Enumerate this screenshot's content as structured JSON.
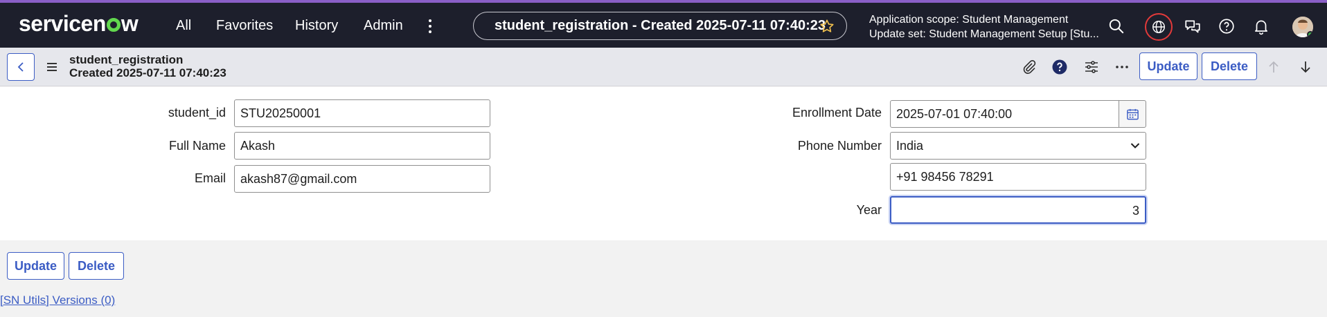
{
  "topnav": {
    "logo": "servicenow",
    "items": [
      "All",
      "Favorites",
      "History",
      "Admin"
    ],
    "record_title": "student_registration - Created 2025-07-11 07:40:23",
    "scope_line1": "Application scope: Student Management",
    "scope_line2": "Update set: Student Management Setup [Stu..."
  },
  "header": {
    "table_name": "student_registration",
    "created": "Created 2025-07-11 07:40:23",
    "update_label": "Update",
    "delete_label": "Delete"
  },
  "form": {
    "student_id": {
      "label": "student_id",
      "value": "STU20250001"
    },
    "full_name": {
      "label": "Full Name",
      "value": "Akash"
    },
    "email": {
      "label": "Email",
      "value": "akash87@gmail.com"
    },
    "enrollment_date": {
      "label": "Enrollment Date",
      "value": "2025-07-01 07:40:00"
    },
    "phone_number": {
      "label": "Phone Number",
      "country": "India",
      "value": "+91 98456 78291"
    },
    "year": {
      "label": "Year",
      "value": "3"
    }
  },
  "footer": {
    "update_label": "Update",
    "delete_label": "Delete",
    "versions_link": "[SN Utils] Versions (0)"
  },
  "colors": {
    "accent": "#3b5cc4",
    "topbar": "#1d1f2c",
    "brand_green": "#62d84e",
    "alert_red": "#e33a3a"
  }
}
